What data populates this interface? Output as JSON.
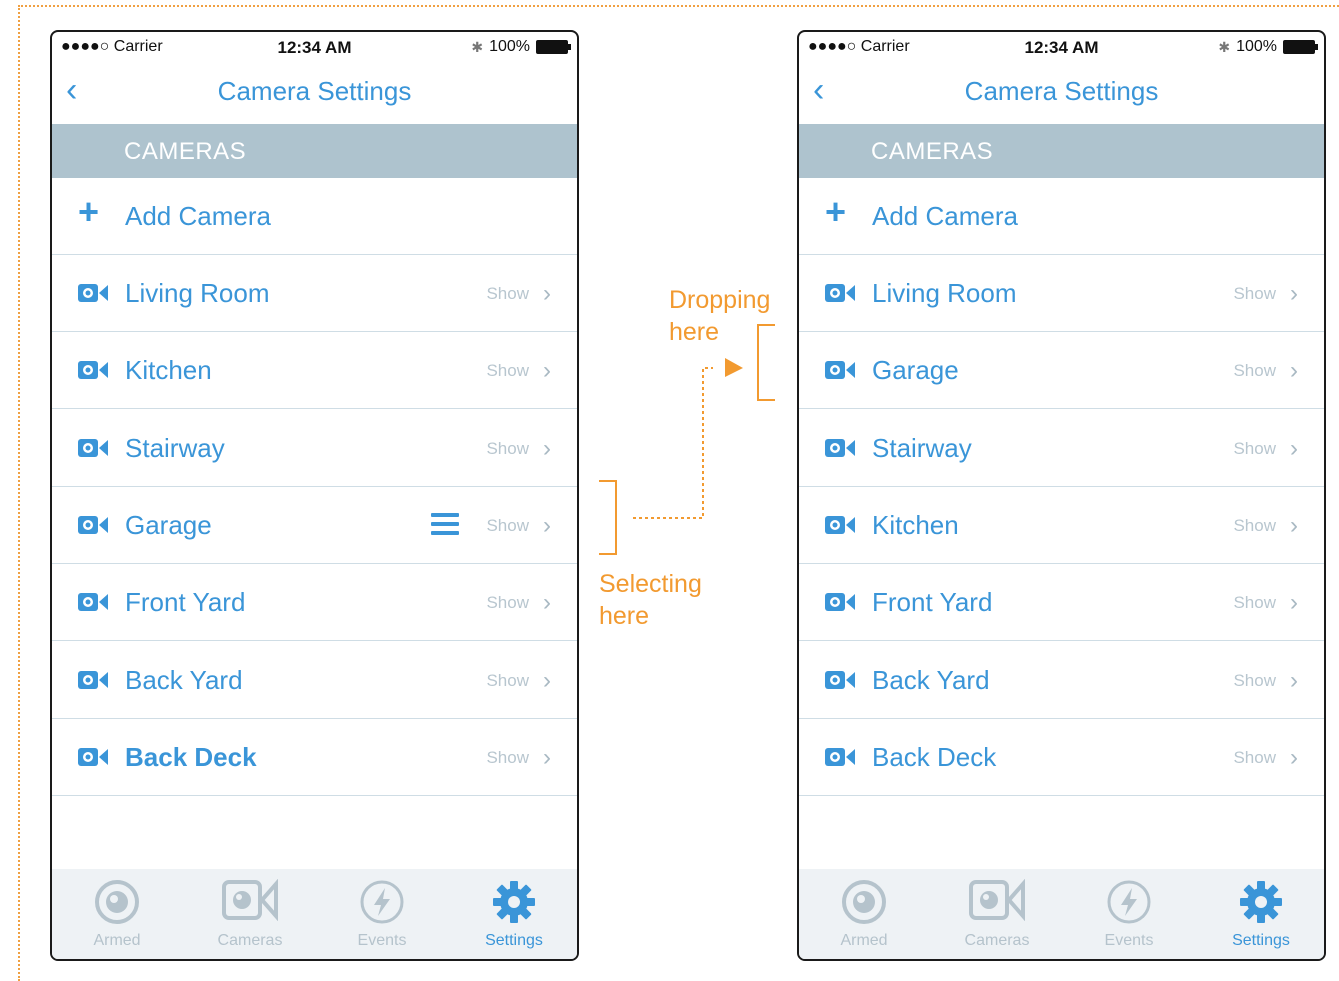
{
  "status": {
    "carrier": "●●●●○ Carrier",
    "time": "12:34 AM",
    "battery": "100%"
  },
  "nav": {
    "title": "Camera Settings"
  },
  "section": {
    "title": "CAMERAS"
  },
  "add_camera": "Add Camera",
  "show_label": "Show",
  "left_rows": [
    "Living Room",
    "Kitchen",
    "Stairway",
    "Garage",
    "Front Yard",
    "Back Yard",
    "Back Deck"
  ],
  "right_rows": [
    "Living Room",
    "Garage",
    "Stairway",
    "Kitchen",
    "Front Yard",
    "Back Yard",
    "Back Deck"
  ],
  "tabs": [
    "Armed",
    "Cameras",
    "Events",
    "Settings"
  ],
  "annotations": {
    "dropping": "Dropping",
    "dropping2": "here",
    "selecting": "Selecting",
    "selecting2": "here"
  },
  "colors": {
    "accent": "#3a95d8",
    "section_bg": "#aec3ce",
    "annotation": "#f29a30"
  }
}
